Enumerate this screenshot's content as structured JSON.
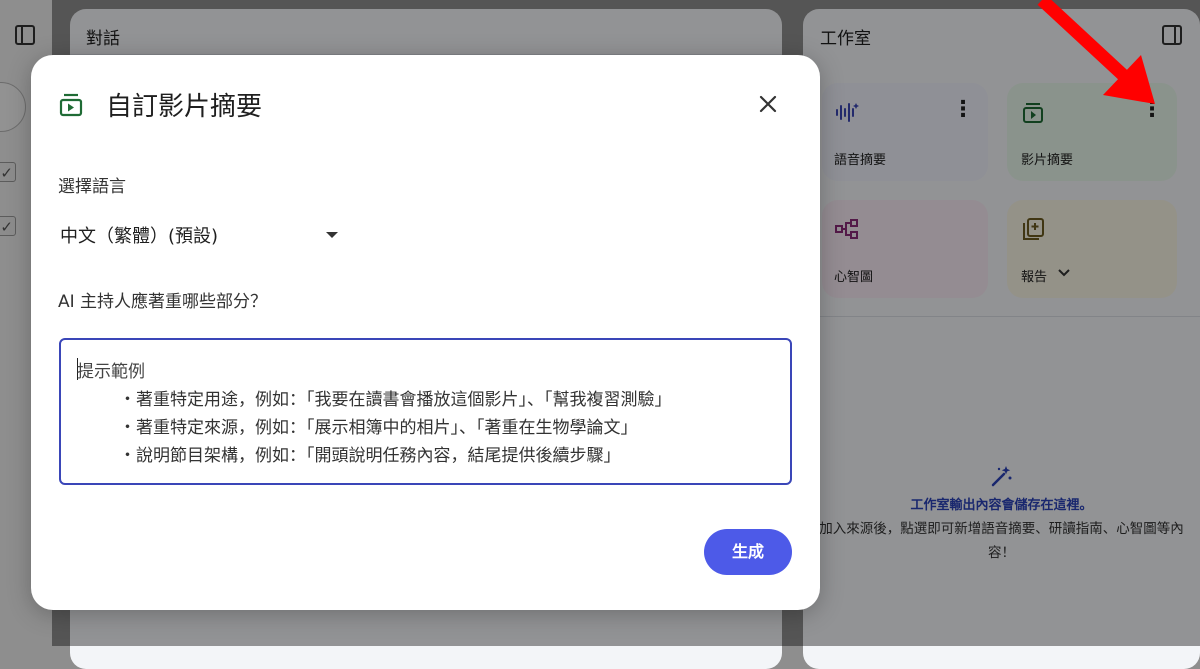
{
  "background": {
    "chat_panel": {
      "title": "對話"
    },
    "studio_panel": {
      "title": "工作室",
      "cards": [
        {
          "label": "語音摘要",
          "icon": "audio-waveform-icon",
          "color": "#eef0fb"
        },
        {
          "label": "影片摘要",
          "icon": "video-summary-icon",
          "color": "#e7f5ea"
        },
        {
          "label": "心智圖",
          "icon": "mind-map-icon",
          "color": "#f7eaf3"
        },
        {
          "label": "報告",
          "icon": "report-icon",
          "color": "#f7f3e3"
        }
      ],
      "empty_state": {
        "title": "工作室輸出內容會儲存在這裡。",
        "description": "加入來源後，點選即可新增語音摘要、研讀指南、心智圖等內容！"
      }
    }
  },
  "dialog": {
    "title": "自訂影片摘要",
    "language_label": "選擇語言",
    "language_value": "中文（繁體）(預設)",
    "focus_question": "AI 主持人應著重哪些部分？",
    "prompt_placeholder": {
      "title": "提示範例",
      "lines": [
        "・著重特定用途，例如：「我要在讀書會播放這個影片」、「幫我複習測驗」",
        "・著重特定來源，例如：「展示相簿中的相片」、「著重在生物學論文」",
        "・說明節目架構，例如：「開頭說明任務內容，結尾提供後續步驟」"
      ]
    },
    "generate_label": "生成"
  },
  "colors": {
    "accent": "#4d5ae8",
    "input_border": "#3a46b8",
    "arrow": "#ff0000",
    "empty_title": "#2b42b8"
  }
}
